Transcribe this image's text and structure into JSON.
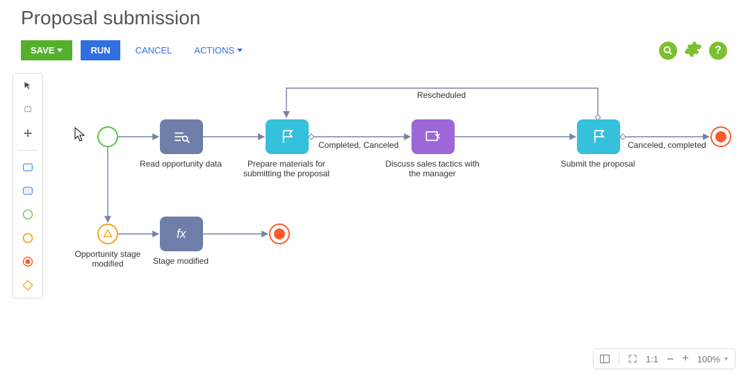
{
  "page": {
    "title": "Proposal submission"
  },
  "toolbar": {
    "save": "SAVE",
    "run": "RUN",
    "cancel": "CANCEL",
    "actions": "ACTIONS"
  },
  "palette": {
    "items": [
      "pointer",
      "lasso",
      "pan",
      "rect-task",
      "subtask",
      "start-event",
      "intermediate-event",
      "end-event",
      "gateway"
    ]
  },
  "nodes": {
    "start": {
      "label": ""
    },
    "read": {
      "label": "Read opportunity data"
    },
    "prepare": {
      "label": "Prepare materials for submitting the proposal"
    },
    "discuss": {
      "label": "Discuss sales tactics with the manager"
    },
    "submit": {
      "label": "Submit the proposal"
    },
    "inter": {
      "label": "Opportunity stage modified"
    },
    "stage": {
      "label": "Stage modified"
    }
  },
  "edges": {
    "rescheduled": "Rescheduled",
    "completed_canceled": "Completed, Canceled",
    "canceled_completed": "Canceled, completed"
  },
  "zoom": {
    "ratio": "1:1",
    "level": "100%"
  }
}
